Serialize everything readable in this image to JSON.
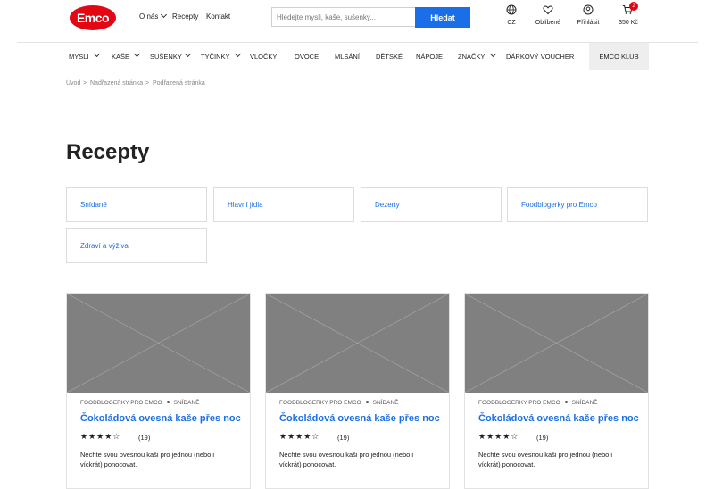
{
  "header": {
    "logo": "Emco",
    "links": [
      {
        "label": "O nás"
      },
      {
        "label": "Recepty"
      },
      {
        "label": "Kontakt"
      }
    ],
    "search": {
      "placeholder": "Hledejte mysli, kaše, sušenky...",
      "button": "Hledat"
    },
    "icons": [
      {
        "icon": "globe-icon",
        "label": "CZ"
      },
      {
        "icon": "heart-icon",
        "label": "Oblíbené"
      },
      {
        "icon": "user-icon",
        "label": "Přihlásit"
      },
      {
        "icon": "cart-icon",
        "label": "350 Kč",
        "badge": "2"
      }
    ]
  },
  "nav": {
    "items": [
      "MYSLI",
      "KAŠE",
      "SUŠENKY",
      "TYČINKY",
      "VLOČKY",
      "OVOCE",
      "MLSÁNÍ",
      "DĚTSKÉ",
      "NÁPOJE",
      "ZNAČKY",
      "DÁRKOVÝ VOUCHER"
    ],
    "club": "EMCO KLUB"
  },
  "breadcrumb": [
    "Úvod",
    "Nadřazená stránka",
    "Podřazená stránka"
  ],
  "page": {
    "title": "Recepty"
  },
  "categories": [
    "Snídaně",
    "Hlavní jídla",
    "Dezerty",
    "Foodblogerky pro Emco",
    "Zdraví a výživa"
  ],
  "cards": [
    {
      "category": "FOODBLOGERKY PRO EMCO",
      "tag": "SNÍDANĚ",
      "title": "Čokoládová ovesná kaše přes noc",
      "stars": "★★★★☆",
      "rating": 4,
      "count": "(19)",
      "desc": "Nechte svou ovesnou kaši pro jednou (nebo i víckrát) ponocovat."
    },
    {
      "category": "FOODBLOGERKY PRO EMCO",
      "tag": "SNÍDANĚ",
      "title": "Čokoládová ovesná kaše přes noc",
      "stars": "★★★★☆",
      "rating": 4,
      "count": "(19)",
      "desc": "Nechte svou ovesnou kaši pro jednou (nebo i víckrát) ponocovat."
    },
    {
      "category": "FOODBLOGERKY PRO EMCO",
      "tag": "SNÍDANĚ",
      "title": "Čokoládová ovesná kaše přes noc",
      "stars": "★★★★☆",
      "rating": 4,
      "count": "(19)",
      "desc": "Nechte svou ovesnou kaši pro jednou (nebo i víckrát) ponocovat."
    }
  ],
  "colors": {
    "brand": "#e30613",
    "accent": "#1a6fe8",
    "placeholder": "#808080"
  }
}
